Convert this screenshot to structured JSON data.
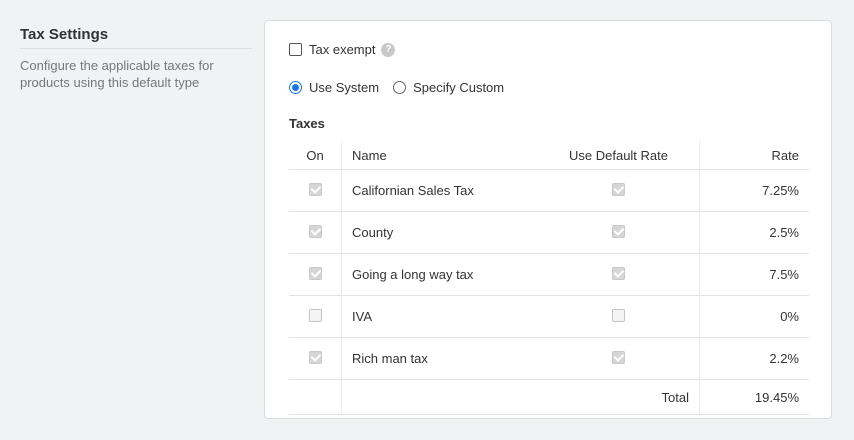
{
  "section": {
    "title": "Tax Settings",
    "description": "Configure the applicable taxes for products using this default type"
  },
  "tax_exempt": {
    "label": "Tax exempt",
    "checked": false,
    "help_icon": "help-circle-icon"
  },
  "mode": {
    "options": [
      {
        "label": "Use System",
        "selected": true
      },
      {
        "label": "Specify Custom",
        "selected": false
      }
    ]
  },
  "taxes": {
    "title": "Taxes",
    "columns": {
      "on": "On",
      "name": "Name",
      "use_default": "Use Default Rate",
      "rate": "Rate"
    },
    "rows": [
      {
        "on": true,
        "name": "Californian Sales Tax",
        "use_default": true,
        "rate": "7.25%"
      },
      {
        "on": true,
        "name": "County",
        "use_default": true,
        "rate": "2.5%"
      },
      {
        "on": true,
        "name": "Going a long way tax",
        "use_default": true,
        "rate": "7.5%"
      },
      {
        "on": false,
        "name": "IVA",
        "use_default": false,
        "rate": "0%"
      },
      {
        "on": true,
        "name": "Rich man tax",
        "use_default": true,
        "rate": "2.2%"
      }
    ],
    "total_label": "Total",
    "total_rate": "19.45%"
  },
  "colors": {
    "accent": "#1a73e8",
    "muted_text": "#777777",
    "border": "#e2e2e2"
  }
}
